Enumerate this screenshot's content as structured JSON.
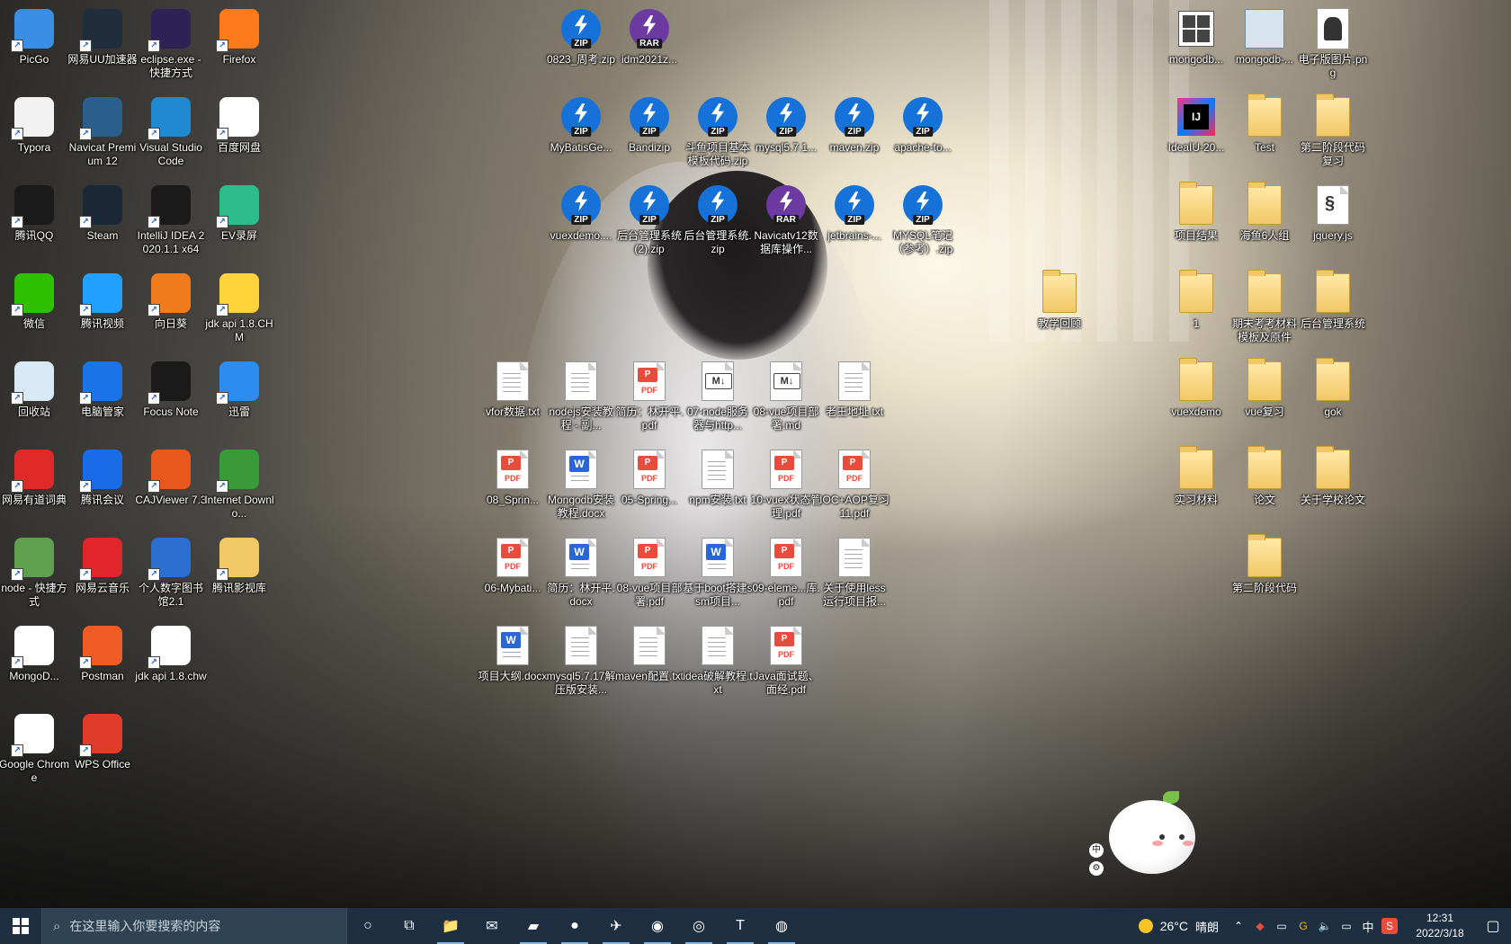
{
  "desktop": {
    "col1": [
      {
        "label": "PicGo",
        "icon": "picgo-icon",
        "color": "#3a8ee6"
      },
      {
        "label": "Typora",
        "icon": "typora-icon",
        "color": "#f2f2f2"
      },
      {
        "label": "腾讯QQ",
        "icon": "qq-icon",
        "color": "#1a1a1a"
      },
      {
        "label": "微信",
        "icon": "wechat-icon",
        "color": "#2dc100"
      },
      {
        "label": "回收站",
        "icon": "recycle-bin-icon",
        "color": "#d9e8f5"
      },
      {
        "label": "网易有道词典",
        "icon": "youdao-icon",
        "color": "#e02a2a"
      },
      {
        "label": "node - 快捷方式",
        "icon": "nodejs-icon",
        "color": "#5fa04e"
      },
      {
        "label": "MongoD...",
        "icon": "mongodb-icon",
        "color": "#ffffff"
      },
      {
        "label": "Google Chrome",
        "icon": "chrome-icon",
        "color": "#ffffff"
      }
    ],
    "col2": [
      {
        "label": "网易UU加速器",
        "icon": "uu-accelerator-icon",
        "color": "#1f2d3d"
      },
      {
        "label": "Navicat Premium 12",
        "icon": "navicat-icon",
        "color": "#2b5f8c"
      },
      {
        "label": "Steam",
        "icon": "steam-icon",
        "color": "#1b2838"
      },
      {
        "label": "腾讯视频",
        "icon": "tencent-video-icon",
        "color": "#20a0ff"
      },
      {
        "label": "电脑管家",
        "icon": "pc-manager-icon",
        "color": "#1a74e8"
      },
      {
        "label": "腾讯会议",
        "icon": "tencent-meeting-icon",
        "color": "#1a6be8"
      },
      {
        "label": "网易云音乐",
        "icon": "netease-music-icon",
        "color": "#e0262b"
      },
      {
        "label": "Postman",
        "icon": "postman-icon",
        "color": "#ef5b25"
      },
      {
        "label": "WPS Office",
        "icon": "wps-icon",
        "color": "#e13c2b"
      }
    ],
    "col3": [
      {
        "label": "eclipse.exe - 快捷方式",
        "icon": "eclipse-icon",
        "color": "#2c2255"
      },
      {
        "label": "Visual Studio Code",
        "icon": "vscode-icon",
        "color": "#1f8ad2"
      },
      {
        "label": "IntelliJ IDEA 2020.1.1 x64",
        "icon": "intellij-icon",
        "color": "#1a1a1a"
      },
      {
        "label": "向日葵",
        "icon": "sunflower-icon",
        "color": "#f07c1b"
      },
      {
        "label": "Focus Note",
        "icon": "focus-note-icon",
        "color": "#1a1a1a"
      },
      {
        "label": "CAJViewer 7.3",
        "icon": "cajviewer-icon",
        "color": "#e8571b"
      },
      {
        "label": "个人数字图书馆2.1",
        "icon": "digital-library-icon",
        "color": "#2b6fd0"
      },
      {
        "label": "jdk api 1.8.chw",
        "icon": "blank-file-icon",
        "color": "#ffffff"
      }
    ],
    "col4": [
      {
        "label": "Firefox",
        "icon": "firefox-icon",
        "color": "#ff7a1a"
      },
      {
        "label": "百度网盘",
        "icon": "baidu-netdisk-icon",
        "color": "#ffffff"
      },
      {
        "label": "EV录屏",
        "icon": "ev-recorder-icon",
        "color": "#2dbd8c"
      },
      {
        "label": "jdk api 1.8.CHM",
        "icon": "chm-help-icon",
        "color": "#ffd43b"
      },
      {
        "label": "迅雷",
        "icon": "xunlei-icon",
        "color": "#2d8cf0"
      },
      {
        "label": "Internet Downlo...",
        "icon": "idm-icon",
        "color": "#3a9a3a"
      },
      {
        "label": "腾讯影视库",
        "icon": "tencent-media-folder-icon",
        "color": "#f2c766"
      }
    ],
    "zips": [
      {
        "label": "0823_周考.zip",
        "kind": "zip"
      },
      {
        "label": "idm2021z...",
        "kind": "rar"
      },
      {
        "label": "MyBatisGe...",
        "kind": "zip"
      },
      {
        "label": "Bandizip",
        "kind": "zip"
      },
      {
        "label": "斗鱼项目基本模板代码.zip",
        "kind": "zip"
      },
      {
        "label": "mysql5.7.1...",
        "kind": "zip"
      },
      {
        "label": "maven.zip",
        "kind": "zip"
      },
      {
        "label": "apache-to...",
        "kind": "zip"
      },
      {
        "label": "vuexdemo....",
        "kind": "zip"
      },
      {
        "label": "后台管理系统(2).zip",
        "kind": "zip"
      },
      {
        "label": "后台管理系统.zip",
        "kind": "zip"
      },
      {
        "label": "Navicatv12数据库操作...",
        "kind": "rar"
      },
      {
        "label": "jetbrains-...",
        "kind": "zip"
      },
      {
        "label": "MYSQL笔记（参考）.zip",
        "kind": "zip"
      }
    ],
    "docs": [
      {
        "label": "vfor数据.txt",
        "kind": "txt"
      },
      {
        "label": "nodejs安装教程 - 副...",
        "kind": "txt"
      },
      {
        "label": "简历：林开平.pdf",
        "kind": "pdf"
      },
      {
        "label": "07-node服务器与http...",
        "kind": "md"
      },
      {
        "label": "08-vue项目部署.md",
        "kind": "md"
      },
      {
        "label": "老王地址.txt",
        "kind": "txt"
      },
      {
        "label": "08_Sprin...",
        "kind": "pdf"
      },
      {
        "label": "Mongodb安装教程.docx",
        "kind": "docx"
      },
      {
        "label": "05-Spring...",
        "kind": "pdf"
      },
      {
        "label": "npm安装.txt",
        "kind": "txt"
      },
      {
        "label": "10-vuex状态管理.pdf",
        "kind": "pdf"
      },
      {
        "label": "IOC+AOP复习11.pdf",
        "kind": "pdf"
      },
      {
        "label": "06-Mybati...",
        "kind": "pdf"
      },
      {
        "label": "简历：林开平.docx",
        "kind": "docx"
      },
      {
        "label": "08-vue项目部署.pdf",
        "kind": "pdf"
      },
      {
        "label": "基于boot搭建ssm项目...",
        "kind": "docx"
      },
      {
        "label": "09-eleme...库.pdf",
        "kind": "pdf"
      },
      {
        "label": "关于使用less运行项目报...",
        "kind": "txt"
      },
      {
        "label": "项目大纲.docx",
        "kind": "docx"
      },
      {
        "label": "mysql5.7.17解压版安装...",
        "kind": "txt"
      },
      {
        "label": "maven配置.txt",
        "kind": "txt"
      },
      {
        "label": "idea破解教程.txt",
        "kind": "txt"
      },
      {
        "label": "Java面试题、面经.pdf",
        "kind": "pdf"
      }
    ],
    "right": [
      {
        "label": "mongodb...",
        "kind": "app"
      },
      {
        "label": "mongodb-...",
        "kind": "installer"
      },
      {
        "label": "电子版图片.png",
        "kind": "image"
      },
      {
        "label": "IdeaIU-20...",
        "kind": "intellij"
      },
      {
        "label": "Test",
        "kind": "folder"
      },
      {
        "label": "第二阶段代码复习",
        "kind": "folder"
      },
      {
        "label": "项目结果",
        "kind": "folder"
      },
      {
        "label": "海鱼6人组",
        "kind": "folder"
      },
      {
        "label": "jquery.js",
        "kind": "js"
      },
      {
        "label": "教学回顾",
        "kind": "folder"
      },
      {
        "label": "1",
        "kind": "folder"
      },
      {
        "label": "期末考考材料模板及原件",
        "kind": "folder"
      },
      {
        "label": "后台管理系统",
        "kind": "folder"
      },
      {
        "label": "vuexdemo",
        "kind": "folder"
      },
      {
        "label": "vue复习",
        "kind": "folder"
      },
      {
        "label": "gok",
        "kind": "folder"
      },
      {
        "label": "实习材料",
        "kind": "folder"
      },
      {
        "label": "论文",
        "kind": "folder"
      },
      {
        "label": "关于学校论文",
        "kind": "folder"
      },
      {
        "label": "第二阶段代码",
        "kind": "folder"
      }
    ]
  },
  "taskbar": {
    "search_placeholder": "在这里输入你要搜索的内容",
    "pinned": [
      {
        "name": "cortana-icon",
        "glyph": "○"
      },
      {
        "name": "task-view-icon",
        "glyph": "⧉"
      },
      {
        "name": "file-explorer-icon",
        "glyph": "📁"
      },
      {
        "name": "mail-icon",
        "glyph": "✉"
      },
      {
        "name": "navicat-taskbar-icon",
        "glyph": "▰"
      },
      {
        "name": "firefox-taskbar-icon",
        "glyph": "●"
      },
      {
        "name": "xunlei-taskbar-icon",
        "glyph": "✈"
      },
      {
        "name": "avatar-app-icon",
        "glyph": "◉"
      },
      {
        "name": "chrome-taskbar-icon",
        "glyph": "◎"
      },
      {
        "name": "typora-taskbar-icon",
        "glyph": "T"
      },
      {
        "name": "uu-taskbar-icon",
        "glyph": "◍"
      }
    ],
    "weather": {
      "temp": "26°C",
      "desc": "晴朗"
    },
    "ime": "中",
    "time": "12:31",
    "date": "2022/3/18"
  },
  "floating_ime": {
    "top": "中",
    "bottom": "⚙"
  }
}
